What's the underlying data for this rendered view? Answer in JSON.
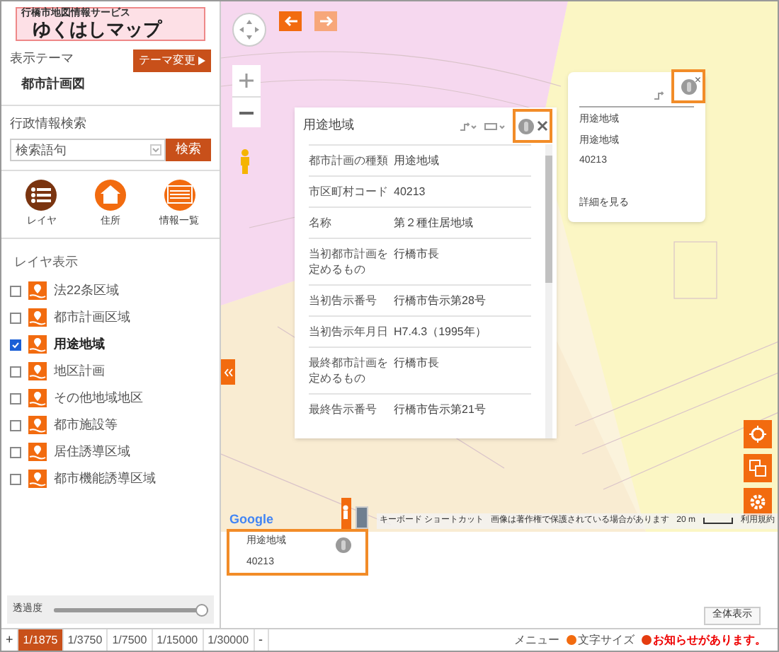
{
  "logo": {
    "subtitle": "行橋市地図情報サービス",
    "title": "ゆくはしマップ"
  },
  "theme": {
    "label": "表示テーマ",
    "value": "都市計画図",
    "button": "テーマ変更"
  },
  "search": {
    "label": "行政情報検索",
    "placeholder": "検索語句",
    "button": "検索"
  },
  "nav_buttons": [
    {
      "kind": "list",
      "label": "レイヤ",
      "selected": true
    },
    {
      "kind": "home",
      "label": "住所",
      "selected": false
    },
    {
      "kind": "table",
      "label": "情報一覧",
      "selected": false
    }
  ],
  "layers": {
    "title": "レイヤ表示",
    "items": [
      {
        "label": "法22条区域",
        "checked": false
      },
      {
        "label": "都市計画区域",
        "checked": false
      },
      {
        "label": "用途地域",
        "checked": true
      },
      {
        "label": "地区計画",
        "checked": false
      },
      {
        "label": "その他地域地区",
        "checked": false
      },
      {
        "label": "都市施設等",
        "checked": false
      },
      {
        "label": "居住誘導区域",
        "checked": false
      },
      {
        "label": "都市機能誘導区域",
        "checked": false
      }
    ]
  },
  "opacity": {
    "label": "透過度",
    "level": 1
  },
  "scales": {
    "zoom_in": "+",
    "zoom_out": "-",
    "items": [
      {
        "label": "1/1875",
        "selected": true
      },
      {
        "label": "1/3750",
        "selected": false
      },
      {
        "label": "1/7500",
        "selected": false
      },
      {
        "label": "1/15000",
        "selected": false
      },
      {
        "label": "1/30000",
        "selected": false
      }
    ]
  },
  "popup": {
    "title": "用途地域",
    "rows": [
      {
        "key": "都市計画の種類",
        "value": "用途地域"
      },
      {
        "key": "市区町村コード",
        "value": "40213"
      },
      {
        "key": "名称",
        "value": "第２種住居地域"
      },
      {
        "key": "当初都市計画を定めるもの",
        "value": "行橋市長"
      },
      {
        "key": "当初告示番号",
        "value": "行橋市告示第28号"
      },
      {
        "key": "当初告示年月日",
        "value": "H7.4.3（1995年）"
      },
      {
        "key": "最終都市計画を定めるもの",
        "value": "行橋市長"
      },
      {
        "key": "最終告示番号",
        "value": "行橋市告示第21号"
      }
    ]
  },
  "mini_popup": {
    "close": "×",
    "lines": [
      "用途地域",
      "用途地域",
      "40213"
    ],
    "link": "詳細を見る"
  },
  "map_footer": {
    "google": "Google",
    "shortcuts": "キーボード ショートカット",
    "copyright": "画像は著作権で保護されている場合があります",
    "scale": "20 m",
    "terms": "利用規約"
  },
  "info_box": {
    "lines": [
      "用途地域",
      "40213"
    ]
  },
  "full_view_button": "全体表示",
  "footer": {
    "menu": "メニュー",
    "font_size": "文字サイズ",
    "notice": "お知らせがあります。"
  }
}
